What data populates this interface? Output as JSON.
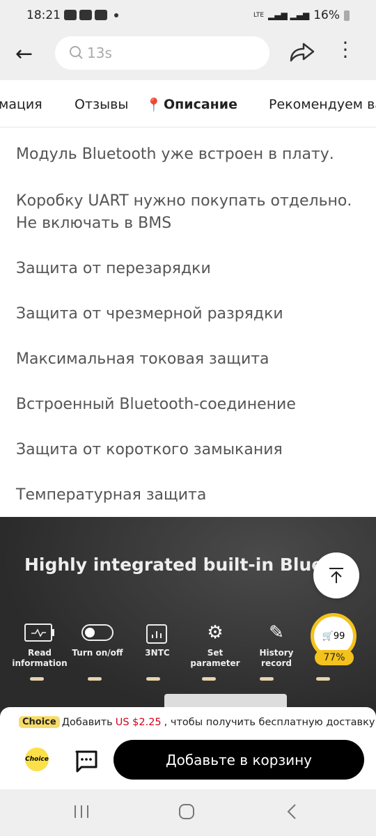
{
  "status_bar": {
    "time": "18:21",
    "network": "LTE",
    "battery": "16%"
  },
  "header": {
    "search_value": "13s",
    "icons": [
      "back-arrow-icon",
      "search-icon",
      "share-icon",
      "more-vert-icon"
    ]
  },
  "tabs": [
    {
      "label": "мация",
      "active": false
    },
    {
      "label": "Отзывы",
      "active": false
    },
    {
      "label": "Описание",
      "active": true
    },
    {
      "label": "Рекомендуем ва",
      "active": false
    }
  ],
  "description": [
    "Модуль Bluetooth уже встроен в плату.",
    "Коробку UART нужно покупать отдельно.",
    "Не включать в BMS",
    "Защита от перезарядки",
    "Защита от чрезмерной разрядки",
    "Максимальная токовая защита",
    "Встроенный Bluetooth-соединение",
    "Защита от короткого замыкания",
    "Температурная защита"
  ],
  "banner": {
    "title": "Highly integrated built-in Bluetooth",
    "features": [
      {
        "label": "Read information",
        "icon": "battery-icon"
      },
      {
        "label": "Turn on/off",
        "icon": "toggle-icon"
      },
      {
        "label": "3NTC",
        "icon": "chart-icon"
      },
      {
        "label": "Set parameter",
        "icon": "gears-icon"
      },
      {
        "label": "History record",
        "icon": "pencil-icon"
      }
    ]
  },
  "floating": {
    "coin_text": "99",
    "coin_progress": "77%",
    "accent": "#f4c21c"
  },
  "bottom_bar": {
    "choice_badge": "Choice",
    "promo_prefix": "Добавить",
    "promo_price": "US $2.25",
    "promo_suffix": ", чтобы получить бесплатную доставку",
    "choice_logo": "Choice",
    "add_to_cart": "Добавьте в корзину",
    "price_color": "#d0021b"
  }
}
